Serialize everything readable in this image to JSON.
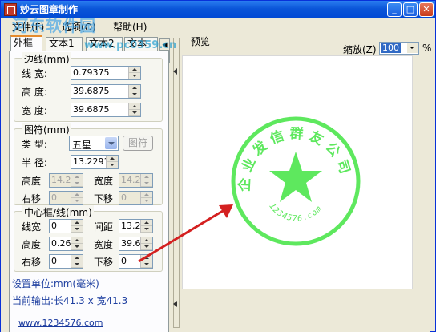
{
  "window": {
    "title": "妙云图章制作",
    "controls": [
      "minimize",
      "maximize",
      "close"
    ],
    "watermark": "河东软件园",
    "watermark_url": "www.pc0359.cn"
  },
  "menu": [
    "文件(F)",
    "选项(O)",
    "帮助(H)"
  ],
  "tabs": [
    "外框",
    "文本1",
    "文本2",
    "文本"
  ],
  "border_group": {
    "legend": "边线(mm)",
    "fields": [
      {
        "label": "线 宽:",
        "value": "0.79375"
      },
      {
        "label": "高 度:",
        "value": "39.6875"
      },
      {
        "label": "宽 度:",
        "value": "39.6875"
      }
    ]
  },
  "symbol_group": {
    "legend": "图符(mm)",
    "type_label": "类 型:",
    "type_value": "五星",
    "symbol_button": "图符",
    "radius_label": "半 径:",
    "radius_value": "13.2291",
    "height_label": "高度",
    "height_value": "14.2",
    "width_label": "宽度",
    "width_value": "14.2",
    "right_label": "右移",
    "right_value": "0",
    "down_label": "下移",
    "down_value": "0"
  },
  "center_group": {
    "legend": "中心框/线(mm)",
    "linewidth_label": "线宽",
    "linewidth_value": "0",
    "spacing_label": "间距",
    "spacing_value": "13.2",
    "height_label": "高度",
    "height_value": "0.26",
    "width_label": "宽度",
    "width_value": "39.6",
    "right_label": "右移",
    "right_value": "0",
    "down_label": "下移",
    "down_value": "0"
  },
  "info": {
    "unit": "设置单位:mm(毫米)",
    "output": "当前输出:长41.3 x 宽41.3"
  },
  "footer_link": "www.1234576.com",
  "preview": {
    "label": "预览",
    "zoom_label": "缩放(Z)",
    "zoom_value": "100",
    "zoom_unit": "%",
    "stamp_text": "企业发信群友公司",
    "stamp_subtext": "1234576.com",
    "stamp_color": "#5ee85e"
  },
  "arrow_color": "#d42020"
}
